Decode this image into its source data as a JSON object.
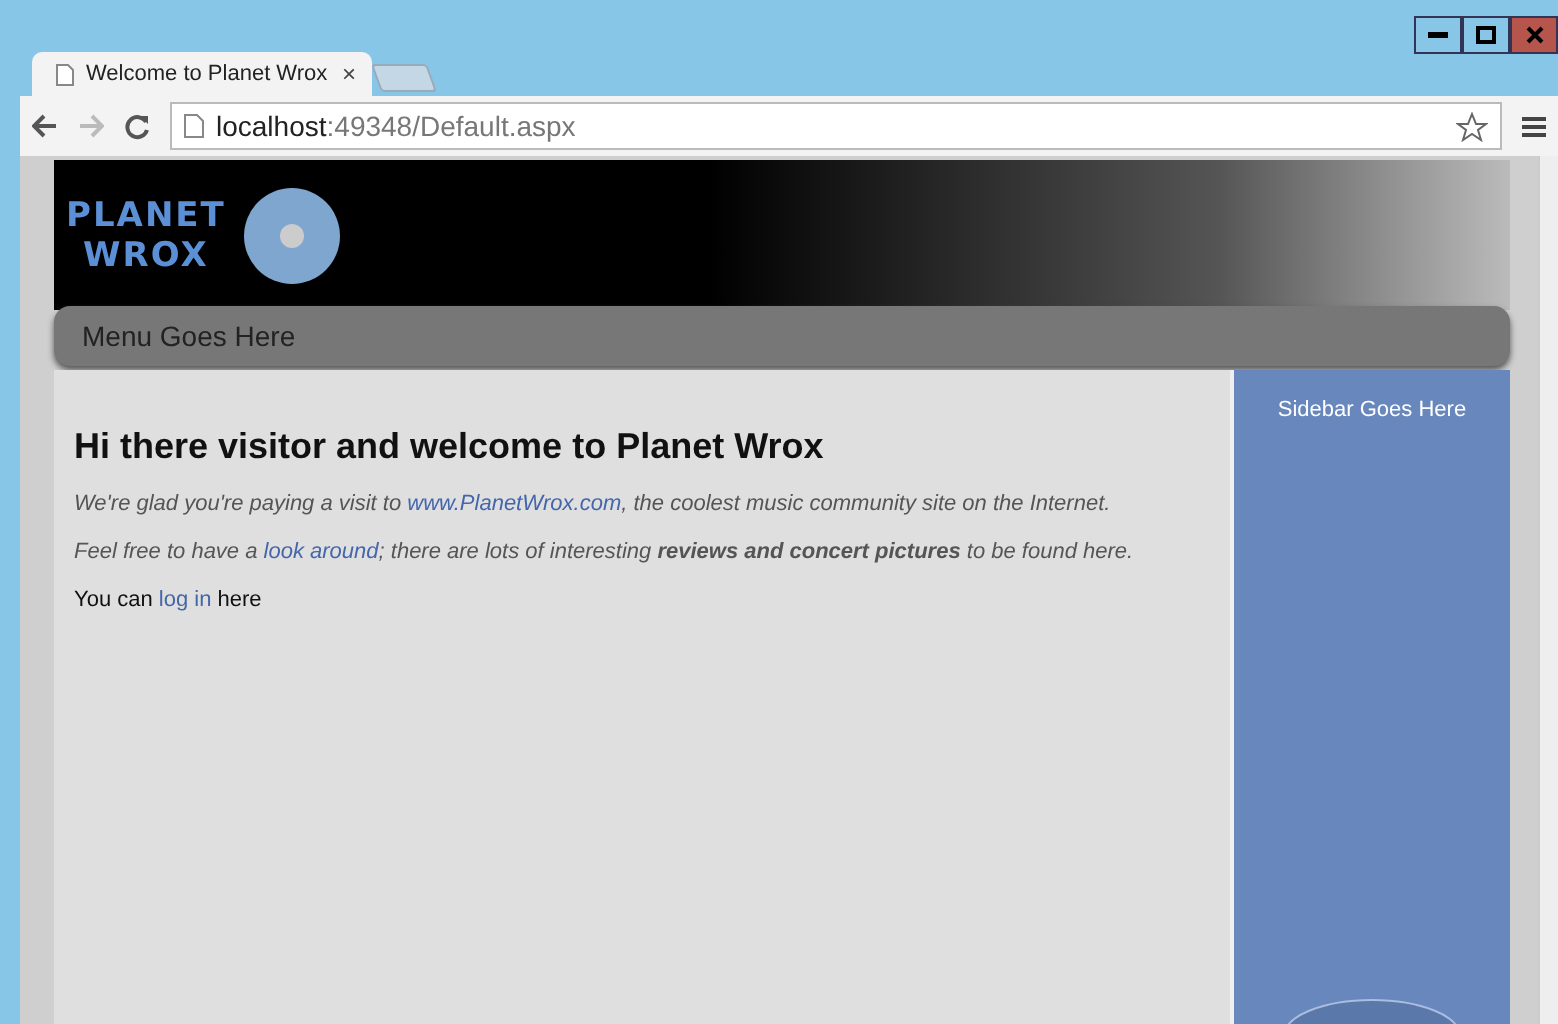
{
  "browser": {
    "tab": {
      "title": "Welcome to Planet Wrox",
      "close": "×"
    },
    "address": {
      "host": "localhost",
      "path": ":49348/Default.aspx"
    }
  },
  "header": {
    "logo": [
      "PLANET",
      "WROX"
    ]
  },
  "menu": {
    "label": "Menu Goes Here"
  },
  "content": {
    "heading": "Hi there visitor and welcome to Planet Wrox",
    "paragraphs": [
      {
        "kind": "intro",
        "parts": [
          {
            "text": "We're glad you're paying a visit to "
          },
          {
            "text": "www.PlanetWrox.com",
            "link": true
          },
          {
            "text": ", the coolest music community site on the Internet."
          }
        ]
      },
      {
        "kind": "intro",
        "parts": [
          {
            "text": "Feel free to have a "
          },
          {
            "text": "look around",
            "link": true
          },
          {
            "text": "; there are lots of interesting **reviews and concert pictures** to be found here."
          }
        ]
      },
      {
        "kind": "plain",
        "parts": [
          {
            "text": "You can "
          },
          {
            "text": "log in",
            "link": true
          },
          {
            "text": " here"
          }
        ]
      }
    ]
  },
  "sidebar": {
    "label": "Sidebar Goes Here"
  }
}
